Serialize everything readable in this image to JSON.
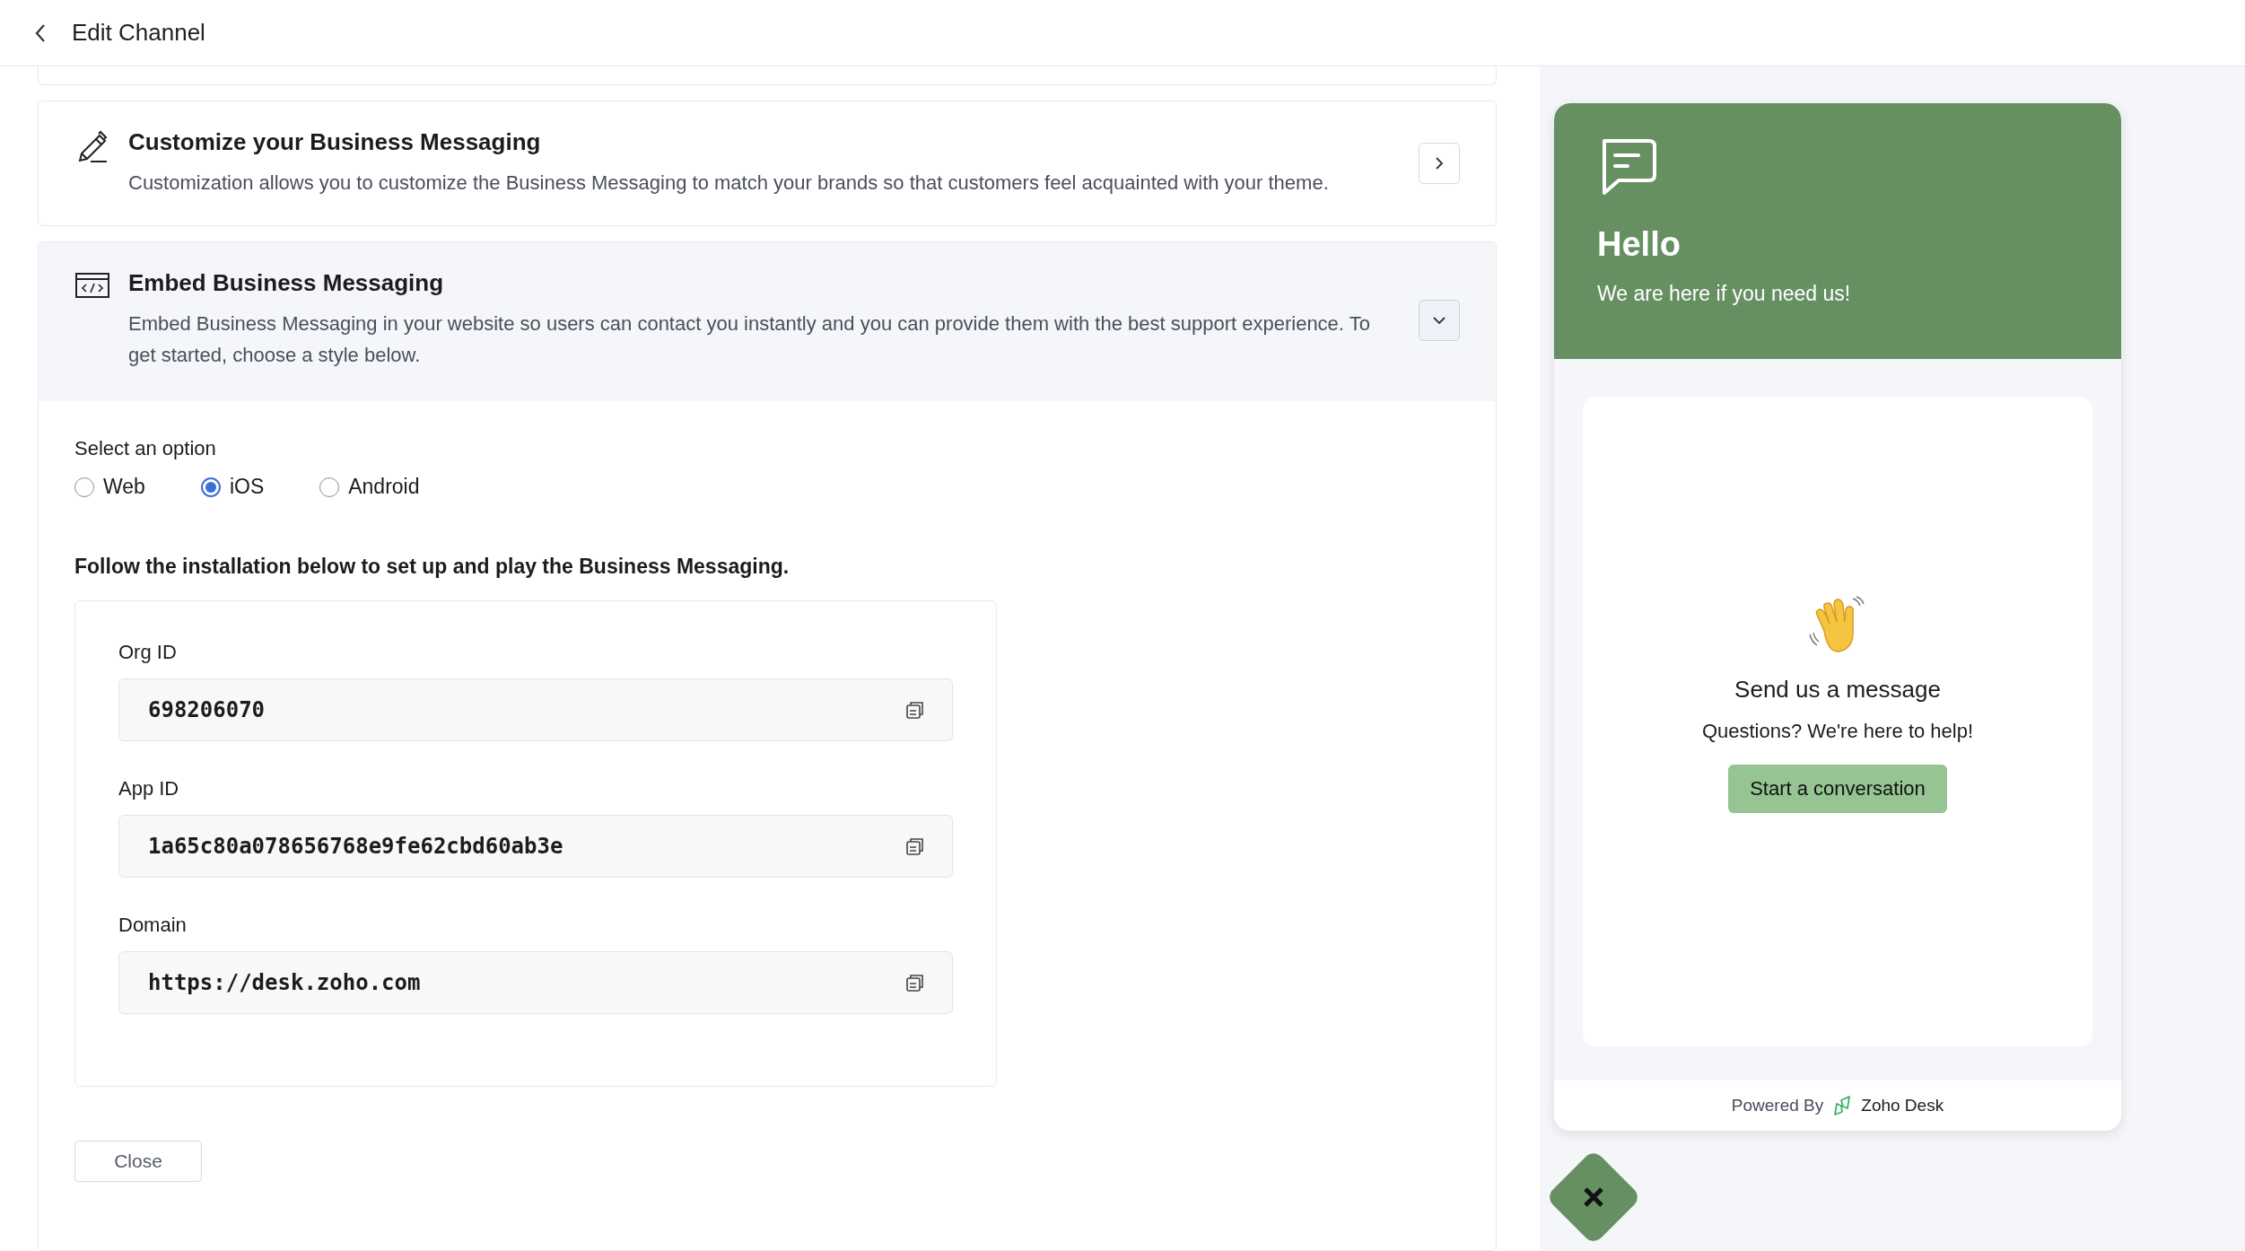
{
  "header": {
    "title": "Edit Channel"
  },
  "sections": [
    {
      "kind": "customize",
      "title": "Customize your Business Messaging",
      "description": "Customization allows you to customize the Business Messaging to match your brands so that customers feel acquainted with your theme.",
      "expanded": false
    },
    {
      "kind": "embed",
      "title": "Embed Business Messaging",
      "description": "Embed Business Messaging in your website so users can contact you instantly and you can provide them with the best support experience. To get started, choose a style below.",
      "expanded": true
    }
  ],
  "platform": {
    "label": "Select an option",
    "options": [
      {
        "label": "Web",
        "selected": false
      },
      {
        "label": "iOS",
        "selected": true
      },
      {
        "label": "Android",
        "selected": false
      }
    ]
  },
  "instructions": "Follow the installation below to set up and play the Business Messaging.",
  "fields": [
    {
      "label": "Org ID",
      "value": "698206070"
    },
    {
      "label": "App ID",
      "value": "1a65c80a078656768e9fe62cbd60ab3e"
    },
    {
      "label": "Domain",
      "value": "https://desk.zoho.com"
    }
  ],
  "close_button": "Close",
  "widget": {
    "greeting": "Hello",
    "subtitle": "We are here if you need us!",
    "message_title": "Send us a message",
    "message_text": "Questions? We're here to help!",
    "cta": "Start a conversation",
    "powered_by": "Powered By",
    "brand": "Zoho Desk"
  }
}
